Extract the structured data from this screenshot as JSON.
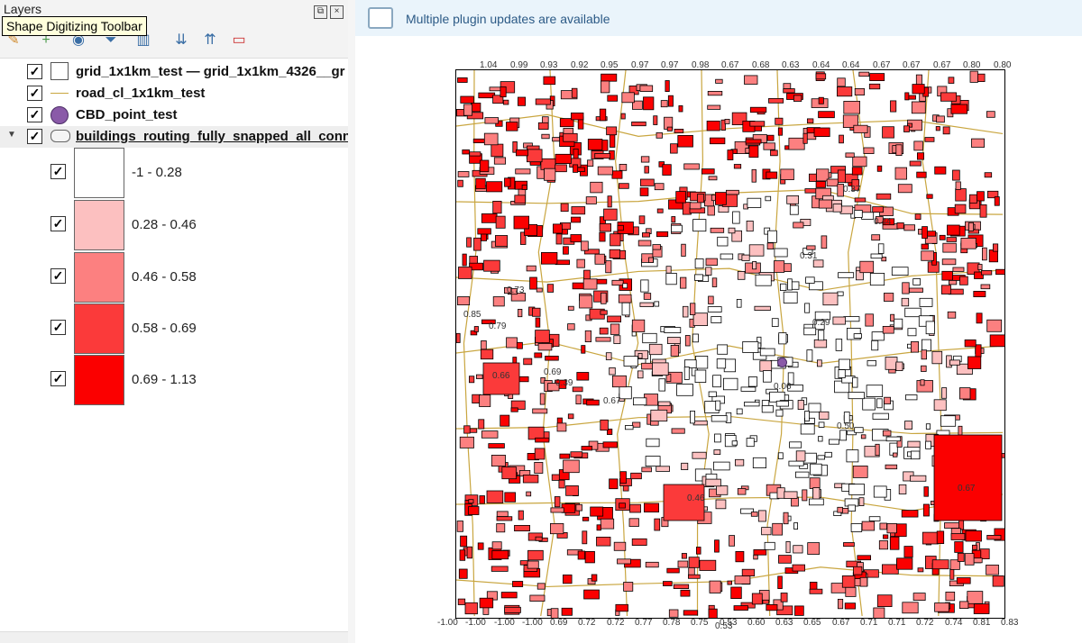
{
  "layers_panel": {
    "title": "Layers",
    "tooltip": "Shape Digitizing Toolbar",
    "layers": [
      {
        "name": "grid_1x1km_test — grid_1x1km_4326__gr",
        "symbol": "square"
      },
      {
        "name": "road_cl_1x1km_test",
        "symbol": "line"
      },
      {
        "name": "CBD_point_test",
        "symbol": "circle"
      },
      {
        "name": "buildings_routing_fully_snapped_all_conn",
        "symbol": "polygon"
      }
    ],
    "legend": [
      {
        "label": "-1 - 0.28",
        "color": "#ffffff"
      },
      {
        "label": "0.28 - 0.46",
        "color": "#fcc0c0"
      },
      {
        "label": "0.46 - 0.58",
        "color": "#fc8080"
      },
      {
        "label": "0.58 - 0.69",
        "color": "#fb3a3a"
      },
      {
        "label": "0.69 - 1.13",
        "color": "#fb0000"
      }
    ]
  },
  "banner": {
    "text": "Multiple plugin updates are available"
  },
  "map": {
    "top_edge_labels": [
      "1.04",
      "0.99",
      "0.93",
      "0.92",
      "0.95",
      "0.97",
      "0.97",
      "0.98",
      "0.67",
      "0.68",
      "0.63",
      "0.64",
      "0.64",
      "0.67",
      "0.67",
      "0.67",
      "0.80",
      "0.80"
    ],
    "bottom_edge_labels": [
      "-1.00",
      "-1.00",
      "-1.00",
      "-1.00",
      "0.69",
      "0.72",
      "0.72",
      "0.77",
      "0.78",
      "0.75",
      "0.53",
      "0.60",
      "0.63",
      "0.65",
      "0.67",
      "0.71",
      "0.71",
      "0.72",
      "0.74",
      "0.81",
      "0.83"
    ],
    "inner_labels": [
      "0.66",
      "0.69",
      "0.39",
      "0.67",
      "0.50",
      "0.67",
      "0.46",
      "0.06",
      "0.53",
      "0.73",
      "0.85",
      "0.79",
      "0.31",
      "0.29",
      "0.37",
      "0.44"
    ],
    "accent_cbd": "#8a5aa8",
    "road_color": "#c9a640"
  }
}
